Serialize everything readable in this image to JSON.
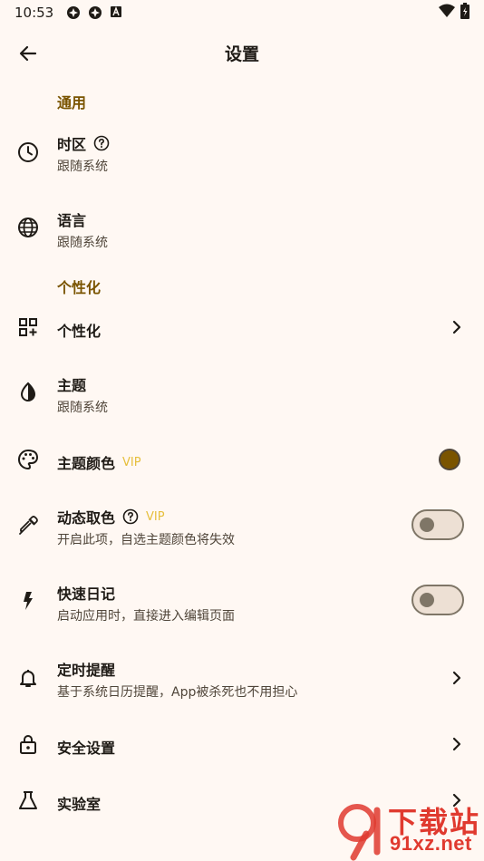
{
  "status_bar": {
    "time": "10:53"
  },
  "header": {
    "title": "设置"
  },
  "sections": {
    "general": "通用",
    "personalize": "个性化"
  },
  "rows": {
    "timezone": {
      "title": "时区",
      "subtitle": "跟随系统"
    },
    "language": {
      "title": "语言",
      "subtitle": "跟随系统"
    },
    "personalize": {
      "title": "个性化"
    },
    "theme": {
      "title": "主题",
      "subtitle": "跟随系统"
    },
    "theme_color": {
      "title": "主题颜色",
      "badge": "VIP",
      "color": "#7a5400"
    },
    "dynamic_color": {
      "title": "动态取色",
      "badge": "VIP",
      "subtitle": "开启此项，自选主题颜色将失效",
      "enabled": false
    },
    "quick_diary": {
      "title": "快速日记",
      "subtitle": "启动应用时，直接进入编辑页面",
      "enabled": false
    },
    "reminder": {
      "title": "定时提醒",
      "subtitle": "基于系统日历提醒，App被杀死也不用担心"
    },
    "security": {
      "title": "安全设置"
    },
    "lab": {
      "title": "实验室"
    }
  },
  "watermark": {
    "cn": "下载站",
    "en": "91xz.net"
  },
  "colors": {
    "accent": "#7a5400",
    "background": "#fff8f3",
    "vip": "#e6bf3c"
  }
}
